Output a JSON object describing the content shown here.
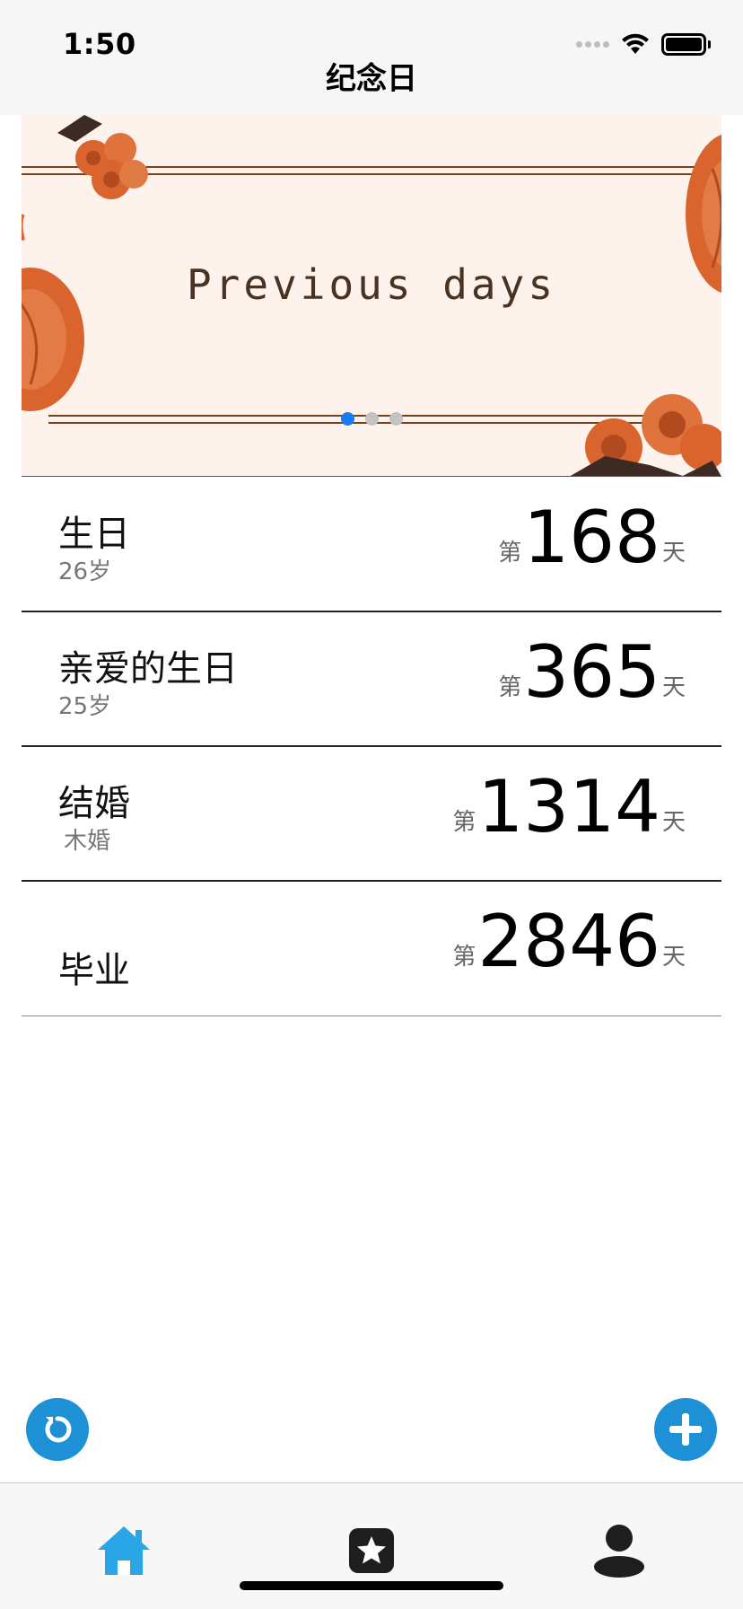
{
  "status_bar": {
    "time": "1:50"
  },
  "nav": {
    "title": "纪念日"
  },
  "banner": {
    "text": "Previous days",
    "page_count": 3,
    "active_page": 1
  },
  "items": [
    {
      "title": "生日",
      "subtitle": "26岁",
      "prefix": "第",
      "count": "168",
      "suffix": "天"
    },
    {
      "title": "亲爱的生日",
      "subtitle": "25岁",
      "prefix": "第",
      "count": "365",
      "suffix": "天"
    },
    {
      "title": "结婚",
      "subtitle": "木婚",
      "prefix": "第",
      "count": "1314",
      "suffix": "天"
    },
    {
      "title": "毕业",
      "subtitle": "",
      "prefix": "第",
      "count": "2846",
      "suffix": "天"
    }
  ],
  "fabs": {
    "refresh_icon": "refresh-icon",
    "add_icon": "plus-icon"
  },
  "tabbar": {
    "tabs": [
      {
        "icon": "home-icon",
        "active": true
      },
      {
        "icon": "star-icon",
        "active": false
      },
      {
        "icon": "person-icon",
        "active": false
      }
    ]
  },
  "colors": {
    "accent": "#1e90d6",
    "tab_active": "#2aa6e6",
    "banner_bg": "#fdf2ec",
    "flower": "#d9642e"
  }
}
